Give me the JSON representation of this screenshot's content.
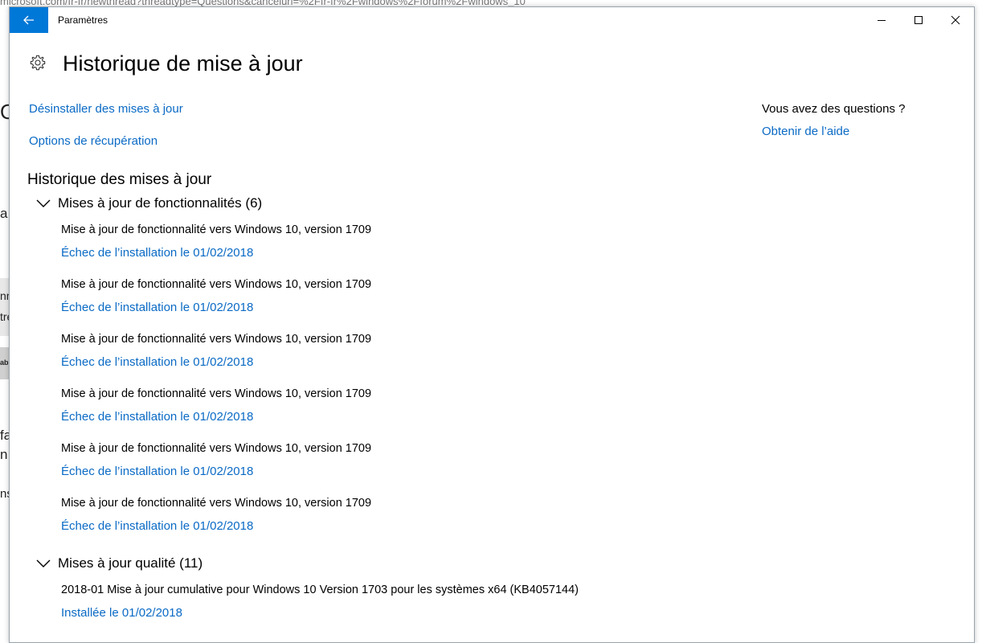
{
  "window": {
    "title": "Paramètres",
    "page_title": "Historique de mise à jour"
  },
  "background": {
    "url_fragment": "microsoft.com/fr-fr/newthread?threadtype=Questions&cancelurl=%2Ffr-fr%2Fwindows%2Fforum%2Fwindows_10",
    "fragments": [
      "O",
      "a",
      "nn",
      "tre",
      "ab",
      "fa",
      "n",
      "ns"
    ]
  },
  "links": {
    "uninstall": "Désinstaller des mises à jour",
    "recovery": "Options de récupération"
  },
  "sidebar": {
    "question": "Vous avez des questions ?",
    "help_link": "Obtenir de l’aide"
  },
  "history": {
    "section_title": "Historique des mises à jour",
    "feature_group": {
      "label": "Mises à jour de fonctionnalités (6)",
      "items": [
        {
          "name": "Mise à jour de fonctionnalité vers Windows 10, version 1709",
          "status": "Échec de l’installation le 01/02/2018"
        },
        {
          "name": "Mise à jour de fonctionnalité vers Windows 10, version 1709",
          "status": "Échec de l’installation le 01/02/2018"
        },
        {
          "name": "Mise à jour de fonctionnalité vers Windows 10, version 1709",
          "status": "Échec de l’installation le 01/02/2018"
        },
        {
          "name": "Mise à jour de fonctionnalité vers Windows 10, version 1709",
          "status": "Échec de l’installation le 01/02/2018"
        },
        {
          "name": "Mise à jour de fonctionnalité vers Windows 10, version 1709",
          "status": "Échec de l’installation le 01/02/2018"
        },
        {
          "name": "Mise à jour de fonctionnalité vers Windows 10, version 1709",
          "status": "Échec de l’installation le 01/02/2018"
        }
      ]
    },
    "quality_group": {
      "label": "Mises à jour qualité (11)",
      "items": [
        {
          "name": "2018-01 Mise à jour cumulative pour Windows 10 Version 1703 pour les systèmes x64 (KB4057144)",
          "status": "Installée le 01/02/2018"
        }
      ]
    }
  },
  "icons": {
    "back": "back-arrow-icon",
    "minimize": "minimize-icon",
    "maximize": "maximize-icon",
    "close": "close-icon",
    "settings": "gear-icon",
    "expand": "chevron-down-icon"
  },
  "colors": {
    "accent": "#0078d7",
    "link": "#0a6ac5"
  }
}
